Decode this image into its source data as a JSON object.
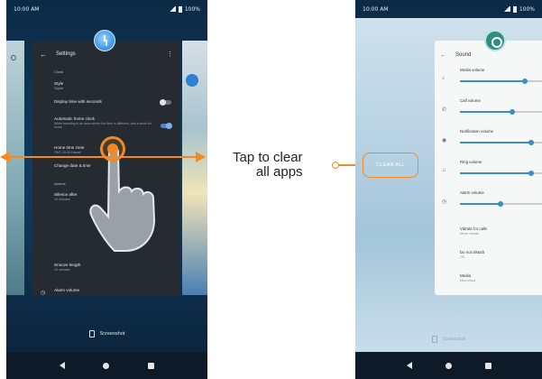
{
  "left_phone": {
    "status_time": "10:00 AM",
    "status_battery": "100%",
    "card_title": "Settings",
    "rows": [
      {
        "label": "Clock",
        "sub": "",
        "kind": "section"
      },
      {
        "label": "Style",
        "sub": "Digital",
        "kind": "row"
      },
      {
        "label": "Display time with seconds",
        "sub": "",
        "kind": "toggle-off"
      },
      {
        "label": "Automatic home clock",
        "sub": "While traveling in an area where the time is different, add a clock for home",
        "kind": "toggle-on"
      },
      {
        "label": "Home time zone",
        "sub": "GMT-10:00 Hawaii",
        "kind": "row"
      },
      {
        "label": "Change date & time",
        "sub": "",
        "kind": "row"
      },
      {
        "label": "Alarms",
        "sub": "",
        "kind": "section"
      },
      {
        "label": "Silence after",
        "sub": "10 minutes",
        "kind": "row"
      },
      {
        "label": "Snooze length",
        "sub": "10 minutes",
        "kind": "row"
      },
      {
        "label": "Alarm volume",
        "sub": "",
        "kind": "row"
      }
    ],
    "bottom_label": "Screenshot"
  },
  "right_phone": {
    "status_time": "10:00 AM",
    "status_battery": "100%",
    "card_title": "Sound",
    "clear_all": "CLEAR ALL",
    "sliders": [
      {
        "label": "Media volume",
        "level": 0.78
      },
      {
        "label": "Call volume",
        "level": 0.62
      },
      {
        "label": "Notification volume",
        "level": 0.85
      },
      {
        "label": "Ring volume",
        "level": 0.85
      },
      {
        "label": "Alarm volume",
        "level": 0.48
      }
    ],
    "rows": [
      {
        "label": "Vibrate for calls",
        "sub": "Never vibrate"
      },
      {
        "label": "Do not disturb",
        "sub": "Off"
      },
      {
        "label": "Media",
        "sub": "Disconnect"
      }
    ],
    "bottom_label": "Screenshot"
  },
  "annotations": {
    "callout_line1": "Tap to clear",
    "callout_line2": "all apps"
  },
  "colors": {
    "accent": "#f08a21",
    "slider": "#3a8ec2"
  }
}
